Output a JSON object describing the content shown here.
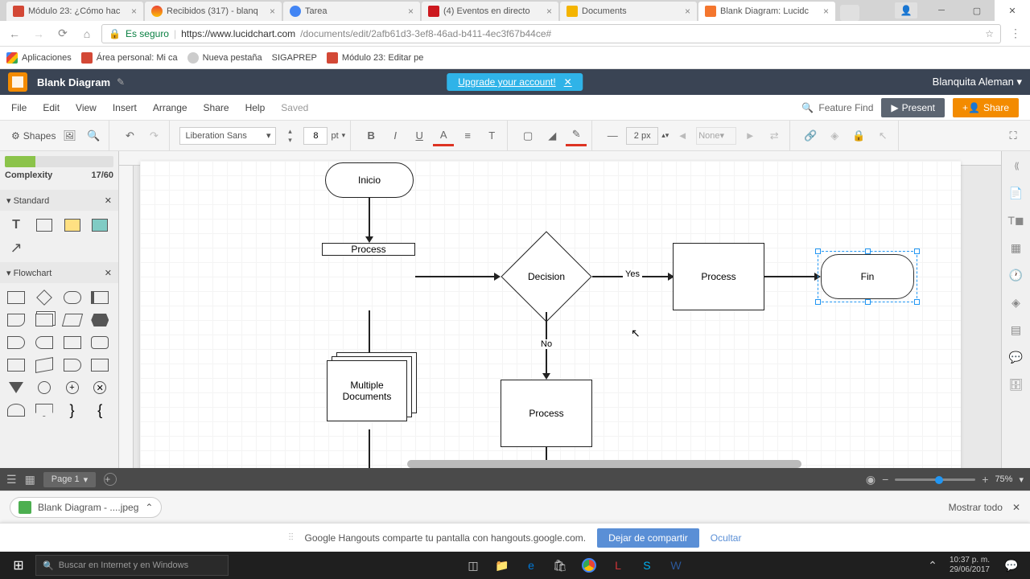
{
  "tabs": [
    {
      "title": "Módulo 23: ¿Cómo hac"
    },
    {
      "title": "Recibidos (317) - blanq"
    },
    {
      "title": "Tarea"
    },
    {
      "title": "(4) Eventos en directo"
    },
    {
      "title": "Documents"
    },
    {
      "title": "Blank Diagram: Lucidc"
    }
  ],
  "url": {
    "secure": "Es seguro",
    "host": "https://www.lucidchart.com",
    "path": "/documents/edit/2afb61d3-3ef8-46ad-b411-4ec3f67b44ce#"
  },
  "bookmarks": {
    "apps": "Aplicaciones",
    "items": [
      "Área personal: Mi ca",
      "Nueva pestaña",
      "SIGAPREP",
      "Módulo 23: Editar pe"
    ]
  },
  "header": {
    "doc_title": "Blank Diagram",
    "upgrade": "Upgrade your account!",
    "user": "Blanquita Aleman ▾"
  },
  "menu": {
    "items": [
      "File",
      "Edit",
      "View",
      "Insert",
      "Arrange",
      "Share",
      "Help"
    ],
    "saved": "Saved",
    "feature_find": "Feature Find",
    "present": "Present",
    "share": "Share"
  },
  "toolbar": {
    "shapes": "Shapes",
    "font": "Liberation Sans",
    "size": "8",
    "unit": "pt",
    "line_width": "2 px",
    "fill": "None"
  },
  "left_panel": {
    "complexity_label": "Complexity",
    "complexity_value": "17/60",
    "standard": "Standard",
    "flowchart": "Flowchart"
  },
  "diagram": {
    "inicio": "Inicio",
    "process1": "Process",
    "decision": "Decision",
    "yes": "Yes",
    "no": "No",
    "process2": "Process",
    "process3": "Process",
    "multidoc": "Multiple\nDocuments",
    "fin": "Fin"
  },
  "page_tabs": {
    "page1": "Page 1",
    "zoom": "75%"
  },
  "download": {
    "file": "Blank Diagram - ....jpeg",
    "show_all": "Mostrar todo"
  },
  "hangouts": {
    "msg": "Google Hangouts comparte tu pantalla con hangouts.google.com.",
    "stop": "Dejar de compartir",
    "hide": "Ocultar"
  },
  "taskbar": {
    "search": "Buscar en Internet y en Windows",
    "time": "10:37 p. m.",
    "date": "29/06/2017"
  }
}
